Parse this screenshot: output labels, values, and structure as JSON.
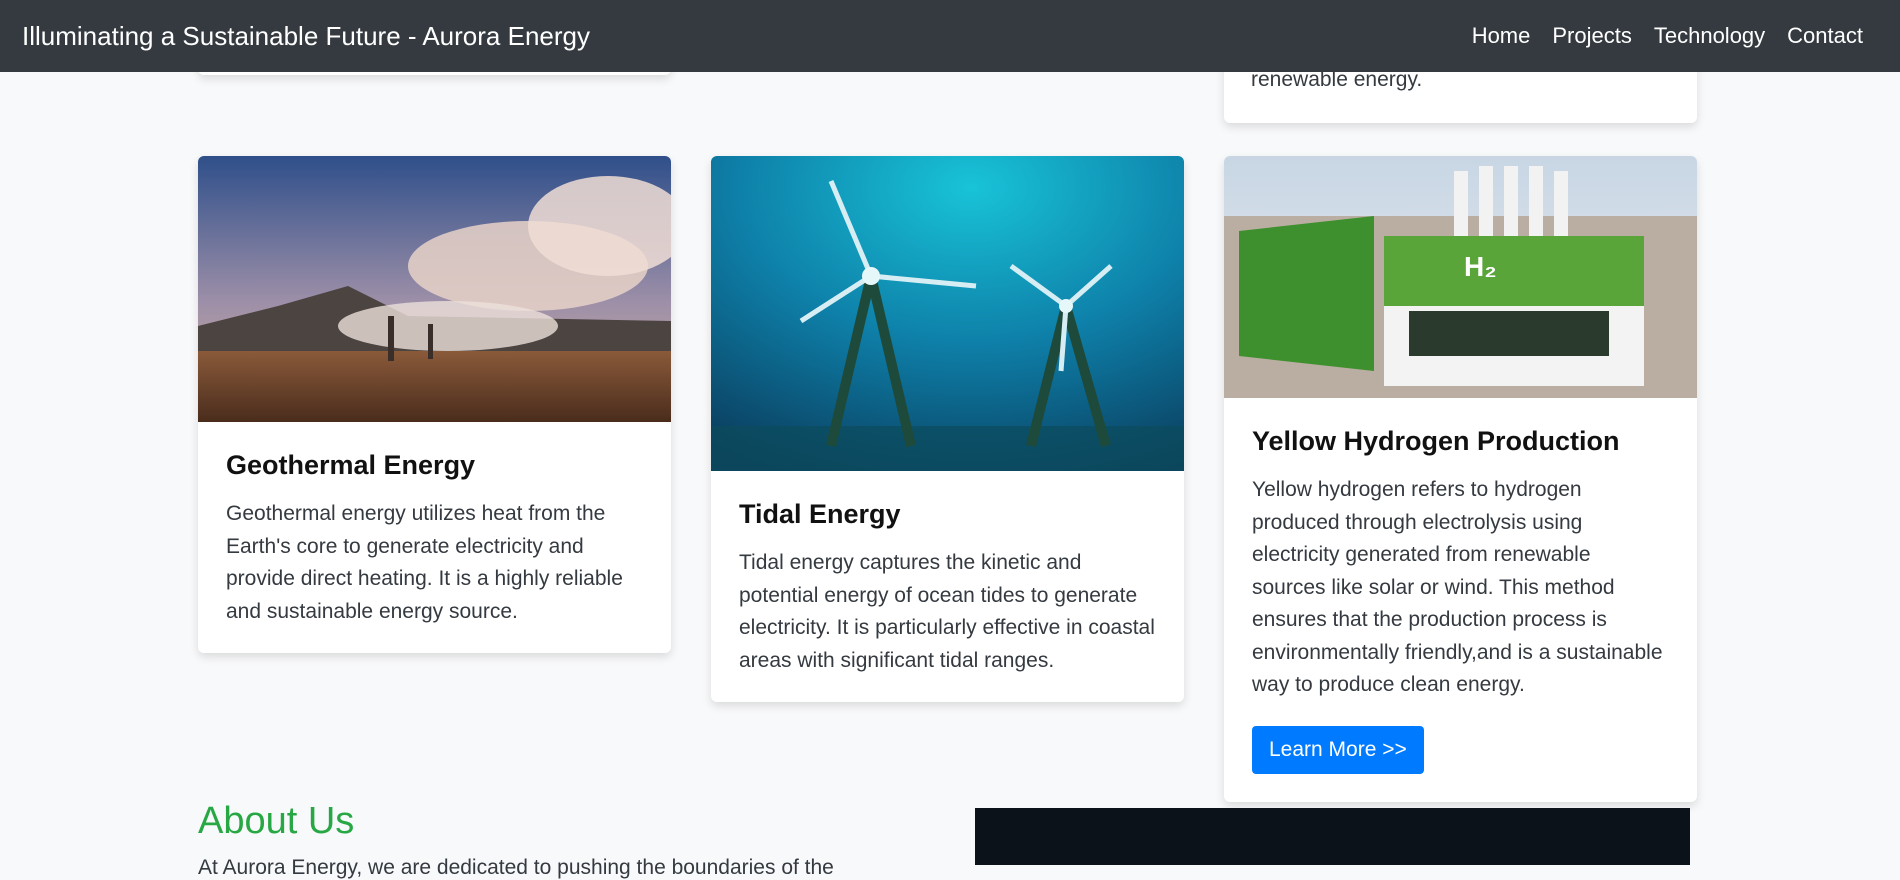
{
  "navbar": {
    "brand": "Illuminating a Sustainable Future - Aurora Energy",
    "links": [
      "Home",
      "Projects",
      "Technology",
      "Contact"
    ]
  },
  "prev_card": {
    "text_tail": "renewable energy."
  },
  "cards": [
    {
      "title": "Geothermal Energy",
      "text": "Geothermal energy utilizes heat from the Earth's core to generate electricity and provide direct heating. It is a highly reliable and sustainable energy source."
    },
    {
      "title": "Tidal Energy",
      "text": "Tidal energy captures the kinetic and potential energy of ocean tides to generate electricity. It is particularly effective in coastal areas with significant tidal ranges."
    },
    {
      "title": "Yellow Hydrogen Production",
      "text": "Yellow hydrogen refers to hydrogen produced through electrolysis using electricity generated from renewable sources like solar or wind. This method ensures that the production process is environmentally friendly,and is a sustainable way to produce clean energy.",
      "button": "Learn More >>"
    }
  ],
  "about": {
    "title": "About Us",
    "text": "At Aurora Energy, we are dedicated to pushing the boundaries of the"
  },
  "colors": {
    "navbar": "#343a40",
    "page_bg": "#f8f9fa",
    "accent_green": "#28a745",
    "button_blue": "#007bff"
  }
}
